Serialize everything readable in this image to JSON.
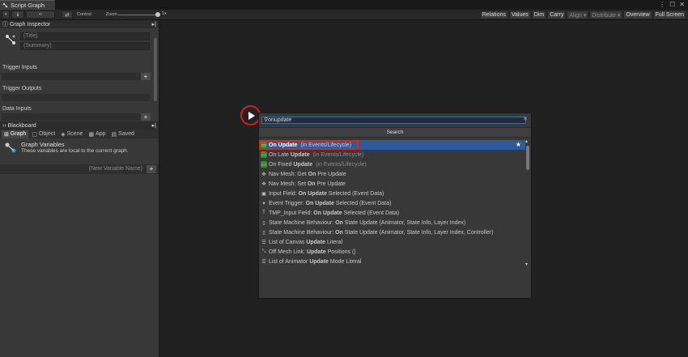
{
  "window": {
    "tab_title": "Script Graph"
  },
  "toolbar": {
    "control_label": "Control",
    "zoom_label": "Zoom",
    "zoom_value": "1x",
    "zoom_level": 1.0,
    "right_buttons": [
      {
        "label": "Relations",
        "dim": false
      },
      {
        "label": "Values",
        "dim": false
      },
      {
        "label": "Dim",
        "dim": false
      },
      {
        "label": "Carry",
        "dim": false
      },
      {
        "label": "Align ▾",
        "dim": true
      },
      {
        "label": "Distribute ▾",
        "dim": true
      },
      {
        "label": "Overview",
        "dim": false
      },
      {
        "label": "Full Screen",
        "dim": false
      }
    ]
  },
  "inspector": {
    "title": "Graph Inspector",
    "title_placeholder": "(Title)",
    "summary_placeholder": "(Summary)",
    "sections": [
      "Trigger Inputs",
      "Trigger Outputs",
      "Data Inputs"
    ]
  },
  "blackboard": {
    "title": "Blackboard",
    "tabs": [
      "Graph",
      "Object",
      "Scene",
      "App",
      "Saved"
    ],
    "active_tab": "Graph",
    "vars_title": "Graph Variables",
    "vars_subtitle": "These variables are local to the current graph.",
    "new_var_placeholder": "(New Variable Name)"
  },
  "fuzzy": {
    "query": "onupdate",
    "header": "Search",
    "items": [
      {
        "icon": "event",
        "pre": "",
        "bold": "On Update",
        "post": "",
        "cat": "(in Events/Lifecycle)",
        "selected": true
      },
      {
        "icon": "event",
        "pre": "On Late ",
        "bold": "Update",
        "post": "",
        "cat": "(in Events/Lifecycle)",
        "selected": false
      },
      {
        "icon": "event",
        "pre": "On Fixed ",
        "bold": "Update",
        "post": "",
        "cat": "(in Events/Lifecycle)",
        "selected": false
      },
      {
        "icon": "navmesh",
        "pre": "Nav Mesh: Get ",
        "bold": "On",
        "post": " Pre Update",
        "cat": "",
        "selected": false
      },
      {
        "icon": "navmesh",
        "pre": "Nav Mesh: Set ",
        "bold": "On",
        "post": " Pre Update",
        "cat": "",
        "selected": false
      },
      {
        "icon": "input",
        "pre": "Input Field: ",
        "bold": "On Update",
        "post": " Selected (Event Data)",
        "cat": "",
        "selected": false
      },
      {
        "icon": "trigger",
        "pre": "Event Trigger: ",
        "bold": "On Update",
        "post": " Selected (Event Data)",
        "cat": "",
        "selected": false
      },
      {
        "icon": "tmp",
        "pre": "TMP_Input Field: ",
        "bold": "On Update",
        "post": " Selected (Event Data)",
        "cat": "",
        "selected": false
      },
      {
        "icon": "doc",
        "pre": "State Machine Behaviour: ",
        "bold": "On",
        "post": " State Update (Animator, State Info, Layer Index)",
        "cat": "",
        "selected": false
      },
      {
        "icon": "doc",
        "pre": "State Machine Behaviour: ",
        "bold": "On",
        "post": " State Update (Animator, State Info, Layer Index, Controller)",
        "cat": "",
        "selected": false
      },
      {
        "icon": "list",
        "pre": "List of Canvas ",
        "bold": "Update",
        "post": " Literal",
        "cat": "",
        "selected": false
      },
      {
        "icon": "link",
        "pre": "Off Mesh Link: ",
        "bold": "Update",
        "post": " Positions ()",
        "cat": "",
        "selected": false
      },
      {
        "icon": "list",
        "pre": "List of Animator ",
        "bold": "Update",
        "post": " Mode Literal",
        "cat": "",
        "selected": false
      }
    ]
  }
}
